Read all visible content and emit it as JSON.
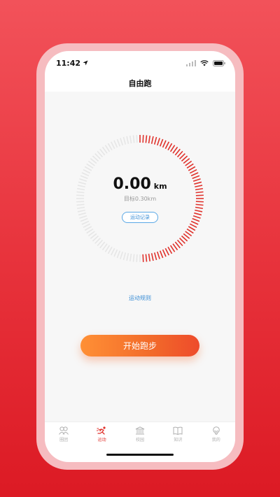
{
  "status_bar": {
    "time": "11:42"
  },
  "nav": {
    "title": "自由跑"
  },
  "run": {
    "distance_value": "0.00",
    "distance_unit": "km",
    "target_text": "目标0.30km",
    "progress_fraction": 0.5,
    "record_button": "运动记录"
  },
  "rules_link": "运动规则",
  "start_button": "开始跑步",
  "tabs": [
    {
      "label": "圈团",
      "icon": "group-icon",
      "active": false
    },
    {
      "label": "运动",
      "icon": "running-icon",
      "active": true
    },
    {
      "label": "校园",
      "icon": "campus-icon",
      "active": false
    },
    {
      "label": "知识",
      "icon": "book-icon",
      "active": false
    },
    {
      "label": "我的",
      "icon": "profile-icon",
      "active": false
    }
  ],
  "colors": {
    "accent": "#e0322c",
    "ring_inactive": "#e6e6e6",
    "link": "#3d8fd6",
    "button_start": "#ff9035",
    "button_end": "#ee4b2b"
  }
}
